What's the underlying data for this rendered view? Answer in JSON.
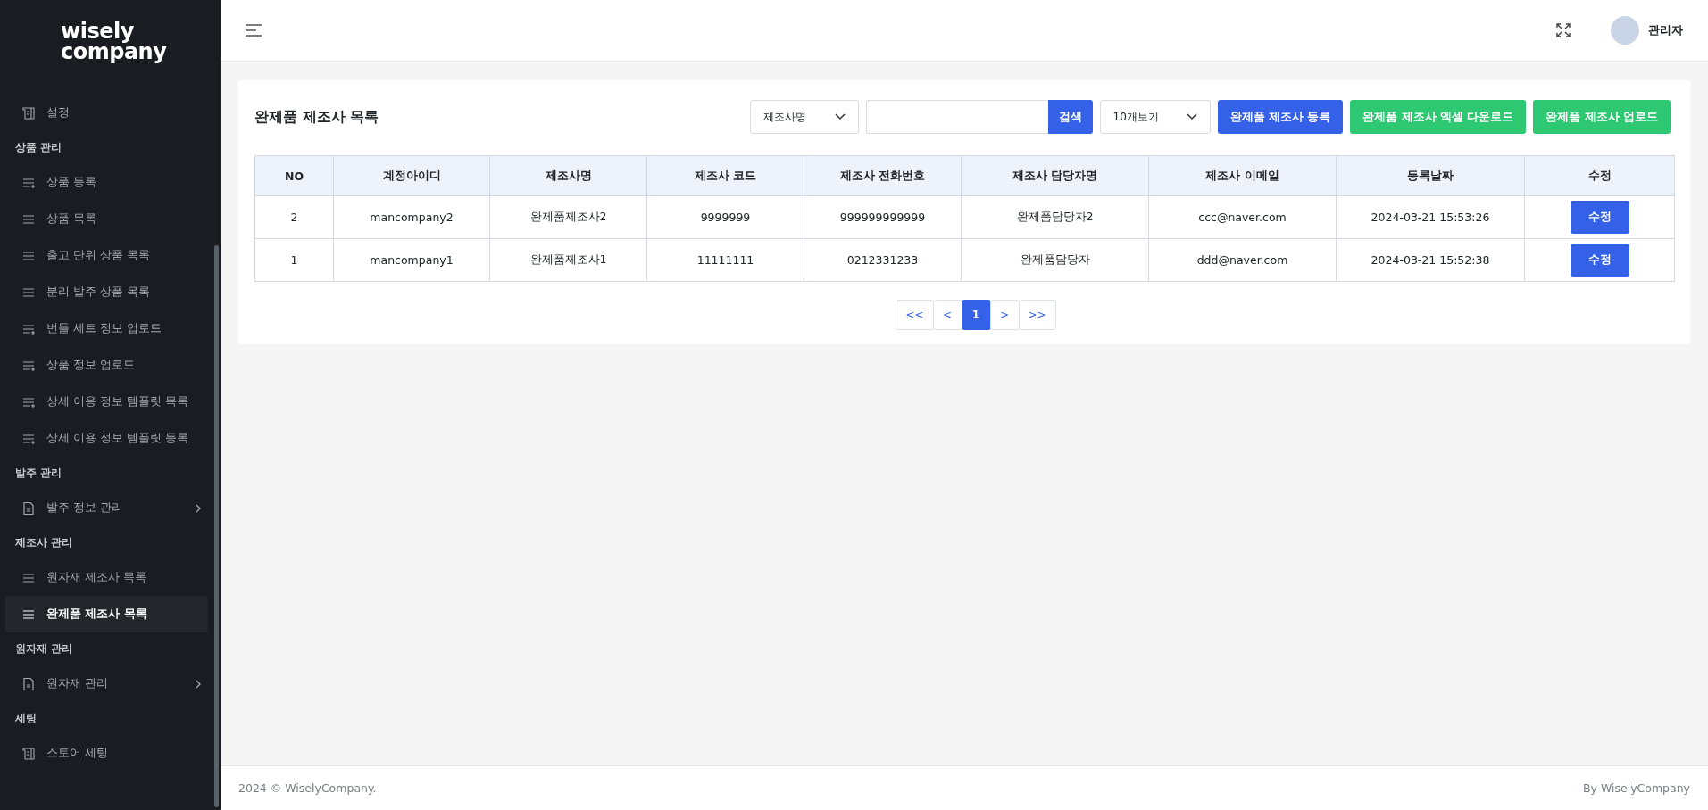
{
  "sidebar": {
    "logo": [
      "wisely",
      "company"
    ],
    "sections": [
      {
        "items": [
          {
            "label": "설정",
            "kind": "doc",
            "selected": false,
            "has_submenu": false
          }
        ]
      },
      {
        "title": "상품 관리",
        "items": [
          {
            "label": "상품 등록",
            "kind": "list-plus",
            "selected": false,
            "has_submenu": false
          },
          {
            "label": "상품 목록",
            "kind": "list",
            "selected": false,
            "has_submenu": false
          },
          {
            "label": "출고 단위 상품 목록",
            "kind": "list",
            "selected": false,
            "has_submenu": false
          },
          {
            "label": "분리 발주 상품 목록",
            "kind": "list",
            "selected": false,
            "has_submenu": false
          },
          {
            "label": "번들 세트 정보 업로드",
            "kind": "list-plus",
            "selected": false,
            "has_submenu": false
          },
          {
            "label": "상품 정보 업로드",
            "kind": "list-plus",
            "selected": false,
            "has_submenu": false
          },
          {
            "label": "상세 이용 정보 템플릿 목록",
            "kind": "list-plus",
            "selected": false,
            "has_submenu": false
          },
          {
            "label": "상세 이용 정보 템플릿 등록",
            "kind": "list-plus",
            "selected": false,
            "has_submenu": false
          }
        ]
      },
      {
        "title": "발주 관리",
        "items": [
          {
            "label": "발주 정보 관리",
            "kind": "file",
            "selected": false,
            "has_submenu": true
          }
        ]
      },
      {
        "title": "제조사 관리",
        "items": [
          {
            "label": "원자재 제조사 목록",
            "kind": "list",
            "selected": false,
            "has_submenu": false
          },
          {
            "label": "완제품 제조사 목록",
            "kind": "list",
            "selected": true,
            "has_submenu": false
          }
        ]
      },
      {
        "title": "원자재 관리",
        "items": [
          {
            "label": "원자재 관리",
            "kind": "file",
            "selected": false,
            "has_submenu": true
          }
        ]
      },
      {
        "title": "세팅",
        "items": [
          {
            "label": "스토어 세팅",
            "kind": "doc",
            "selected": false,
            "has_submenu": false
          }
        ]
      }
    ]
  },
  "header": {
    "user_name": "관리자"
  },
  "card": {
    "title": "완제품 제조사 목록",
    "filter_select": "제조사명",
    "search_button": "검색",
    "page_size_select": "10개보기",
    "buttons": [
      {
        "label": "완제품 제조사 등록",
        "kind": "primary"
      },
      {
        "label": "완제품 제조사 엑셀 다운로드",
        "kind": "success"
      },
      {
        "label": "완제품 제조사 업로드",
        "kind": "success"
      }
    ],
    "table": {
      "columns": [
        "NO",
        "계정아이디",
        "제조사명",
        "제조사 코드",
        "제조사 전화번호",
        "제조사 담당자명",
        "제조사 이메일",
        "등록날짜",
        "수정"
      ],
      "rows": [
        {
          "cells": [
            "2",
            "mancompany2",
            "완제품제조사2",
            "9999999",
            "999999999999",
            "완제품담당자2",
            "ccc@naver.com",
            "2024-03-21 15:53:26"
          ],
          "action": "수정"
        },
        {
          "cells": [
            "1",
            "mancompany1",
            "완제품제조사1",
            "11111111",
            "0212331233",
            "완제품담당자",
            "ddd@naver.com",
            "2024-03-21 15:52:38"
          ],
          "action": "수정"
        }
      ]
    },
    "pagination": [
      {
        "label": "<<",
        "selected": false
      },
      {
        "label": "<",
        "selected": false
      },
      {
        "label": "1",
        "selected": true
      },
      {
        "label": ">",
        "selected": false
      },
      {
        "label": ">>",
        "selected": false
      }
    ]
  },
  "footer": {
    "left": "2024 © WiselyCompany.",
    "right": "By WiselyCompany"
  }
}
